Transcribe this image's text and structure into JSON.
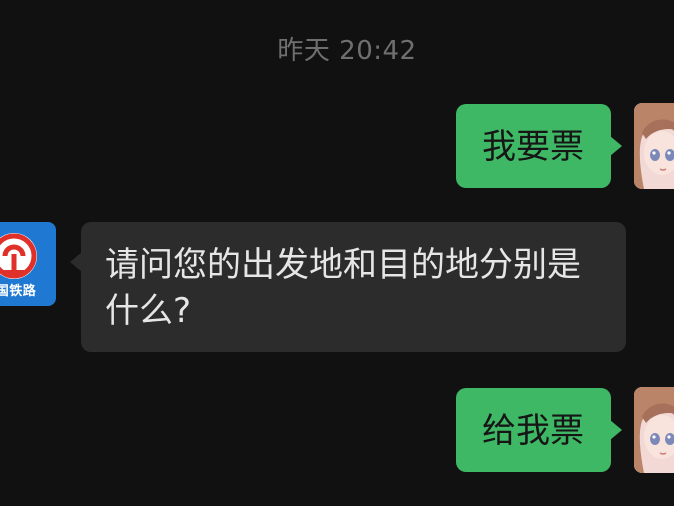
{
  "timestamp": "昨天 20:42",
  "messages": [
    {
      "sender": "user",
      "text": "我要票"
    },
    {
      "sender": "bot",
      "text": "请问您的出发地和目的地分别是什么?"
    },
    {
      "sender": "user",
      "text": "给我票"
    }
  ],
  "bot": {
    "name": "中国铁路",
    "logo_text": "国铁路",
    "brand_color": "#1f78d1",
    "logo_color": "#e0302a"
  },
  "colors": {
    "background": "#111111",
    "outgoing_bubble": "#3fb865",
    "incoming_bubble": "#2c2c2c",
    "timestamp": "#6f6f6f"
  },
  "icons": {
    "user_avatar": "anime-girl-avatar-icon",
    "bot_avatar": "china-railway-logo-icon"
  }
}
